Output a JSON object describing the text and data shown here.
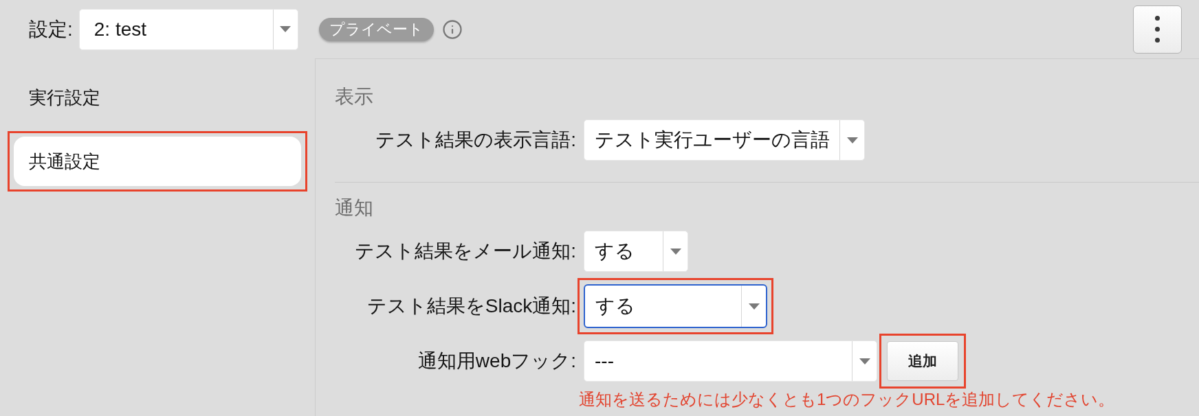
{
  "top_bar": {
    "label": "設定:",
    "select": {
      "value": "2: test"
    },
    "badge": "プライベート"
  },
  "sidebar": {
    "items": [
      {
        "label": "実行設定",
        "selected": false,
        "highlighted": false
      },
      {
        "label": "共通設定",
        "selected": true,
        "highlighted": true
      }
    ]
  },
  "sections": [
    {
      "heading": "表示",
      "fields": [
        {
          "label": "テスト結果の表示言語:",
          "value": "テスト実行ユーザーの言語",
          "focused": false,
          "highlighted": false
        }
      ]
    },
    {
      "heading": "通知",
      "fields": [
        {
          "label": "テスト結果をメール通知:",
          "value": "する",
          "focused": false,
          "highlighted": false
        },
        {
          "label": "テスト結果をSlack通知:",
          "value": "する",
          "focused": true,
          "highlighted": true
        },
        {
          "label": "通知用webフック:",
          "value": "---",
          "focused": false,
          "highlighted": false,
          "button": {
            "label": "追加",
            "highlighted": true
          },
          "error": "通知を送るためには少なくとも1つのフックURLを追加してください。"
        }
      ]
    }
  ]
}
